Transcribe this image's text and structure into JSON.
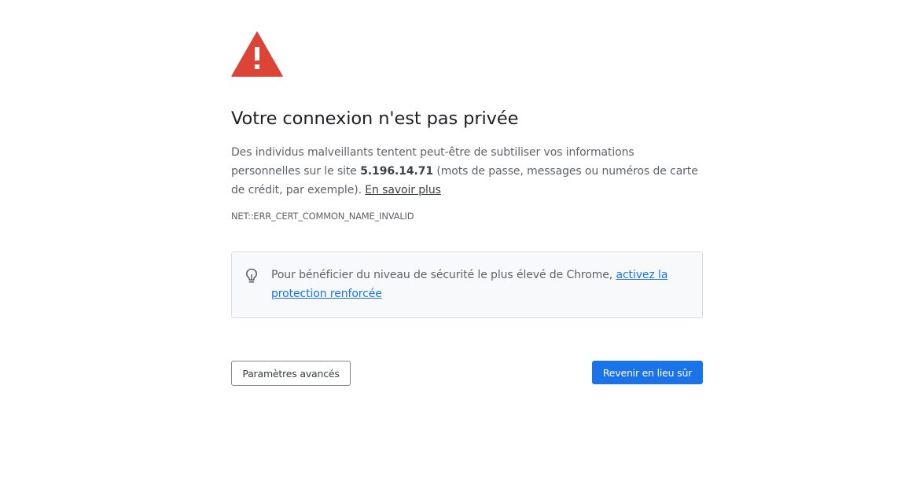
{
  "icons": {
    "warning": "warning-triangle-icon",
    "bulb": "lightbulb-icon"
  },
  "colors": {
    "warning_red": "#db4437",
    "primary_blue": "#1a73e8",
    "link_blue": "#1a73e8",
    "text_gray": "#5f6368",
    "title_color": "#202124",
    "box_bg": "#f8f9fa",
    "box_border": "#dadce0"
  },
  "main": {
    "title": "Votre connexion n'est pas privée",
    "explanation_before_host": "Des individus malveillants tentent peut-être de subtiliser vos informations personnelles sur le site ",
    "host": "5.196.14.71",
    "explanation_after_host": " (mots de passe, messages ou numéros de carte de crédit, par exemple). ",
    "learn_more": "En savoir plus",
    "error_code": "NET::ERR_CERT_COMMON_NAME_INVALID"
  },
  "enhanced_protection": {
    "text": "Pour bénéficier du niveau de sécurité le plus élevé de Chrome, ",
    "link": "activez la protection renforcée"
  },
  "buttons": {
    "advanced": "Paramètres avancés",
    "back_to_safety": "Revenir en lieu sûr"
  }
}
